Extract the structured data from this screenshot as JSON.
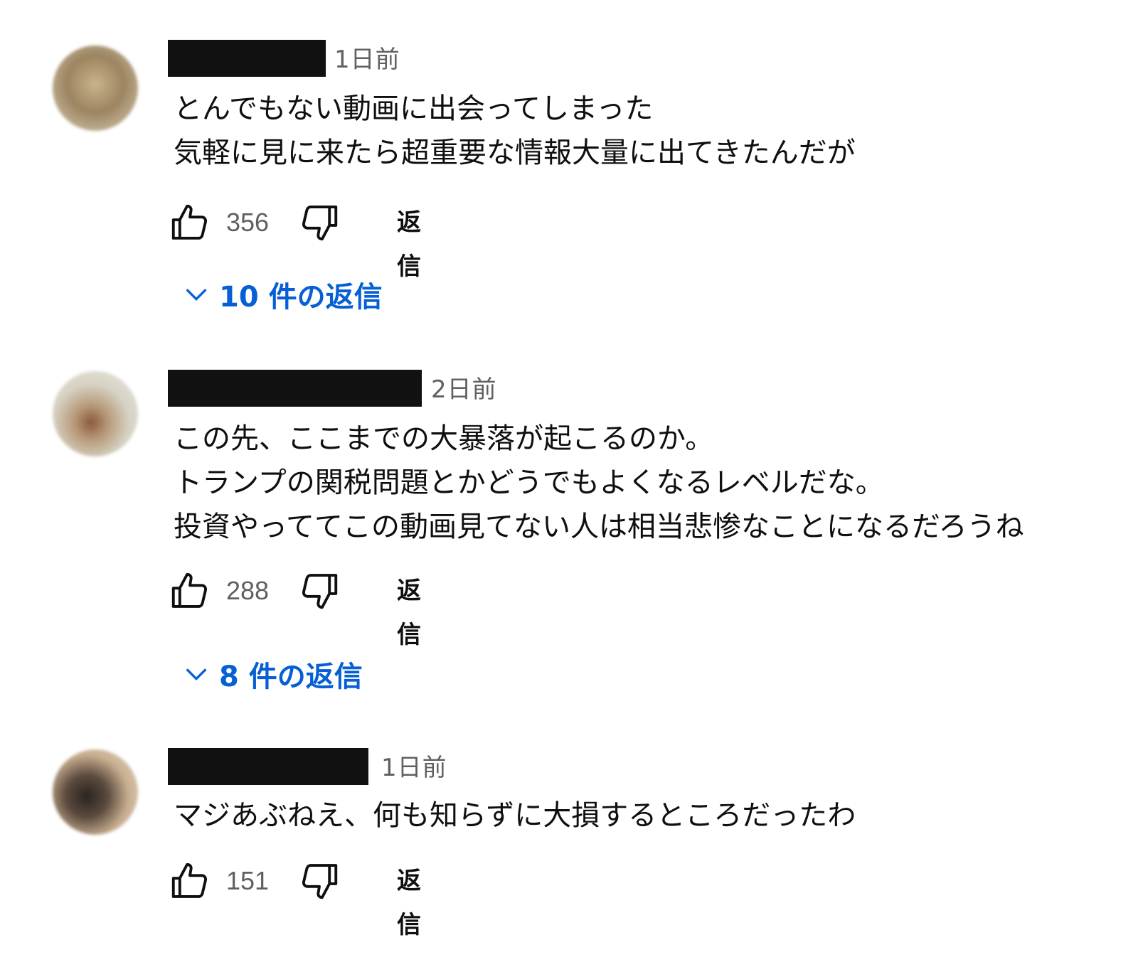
{
  "comments": [
    {
      "time": "1日前",
      "lines": [
        "とんでもない動画に出会ってしまった",
        "気軽に見に来たら超重要な情報大量に出てきたんだが"
      ],
      "likes": "356",
      "reply_label": "返信",
      "replies_label": "10 件の返信"
    },
    {
      "time": "2日前",
      "lines": [
        "この先、ここまでの大暴落が起こるのか。",
        "トランプの関税問題とかどうでもよくなるレベルだな。",
        "投資やっててこの動画見てない人は相当悲惨なことになるだろうね"
      ],
      "likes": "288",
      "reply_label": "返信",
      "replies_label": "8 件の返信"
    },
    {
      "time": "1日前",
      "lines": [
        "マジあぶねえ、何も知らずに大損するところだったわ"
      ],
      "likes": "151",
      "reply_label": "返信"
    }
  ],
  "colors": {
    "link_blue": "#065fd4",
    "meta_gray": "#606060",
    "redaction": "#111111"
  }
}
